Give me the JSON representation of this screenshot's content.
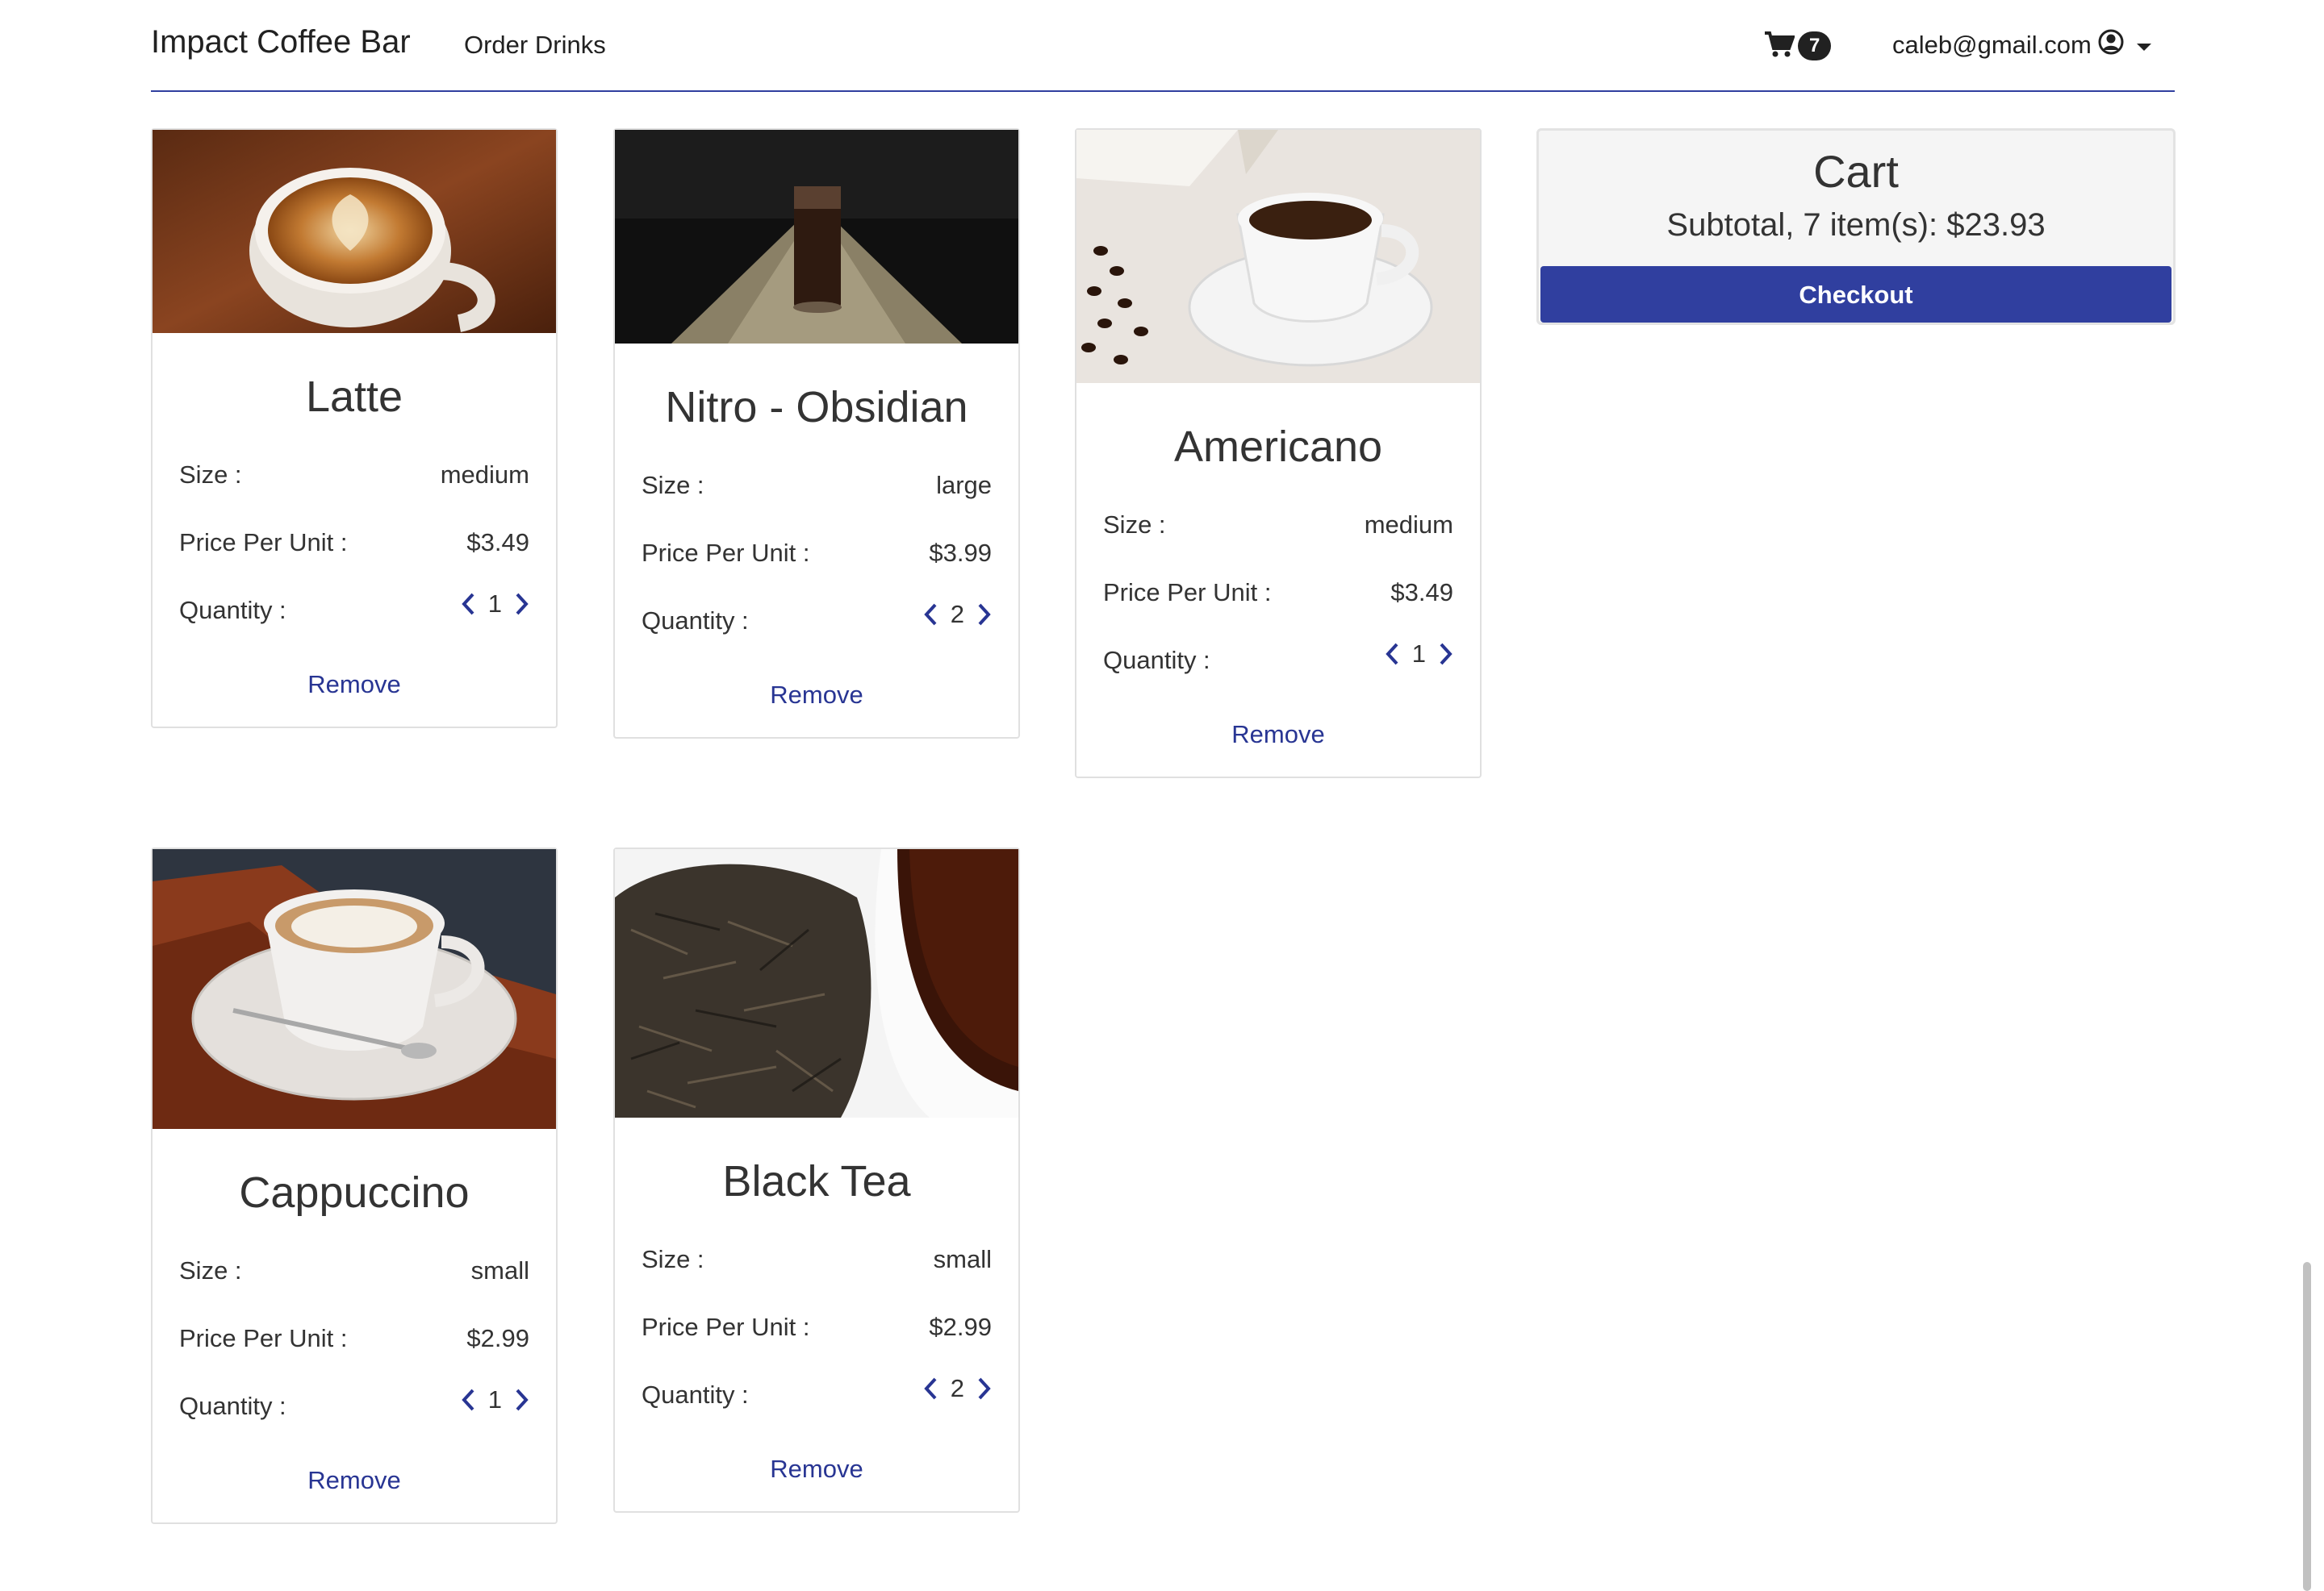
{
  "navbar": {
    "brand": "Impact Coffee Bar",
    "order_link": "Order Drinks",
    "cart_count": "7",
    "user_email": "caleb@gmail.com",
    "accent_color": "#303f9f"
  },
  "labels": {
    "size": "Size :",
    "price": "Price Per Unit :",
    "quantity": "Quantity :",
    "remove": "Remove"
  },
  "items": [
    {
      "name": "Latte",
      "size": "medium",
      "price": "$3.49",
      "quantity": "1"
    },
    {
      "name": "Nitro - Obsidian",
      "size": "large",
      "price": "$3.99",
      "quantity": "2"
    },
    {
      "name": "Americano",
      "size": "medium",
      "price": "$3.49",
      "quantity": "1"
    },
    {
      "name": "Cappuccino",
      "size": "small",
      "price": "$2.99",
      "quantity": "1"
    },
    {
      "name": "Black Tea",
      "size": "small",
      "price": "$2.99",
      "quantity": "2"
    }
  ],
  "cart": {
    "title": "Cart",
    "subtotal": "Subtotal, 7 item(s): $23.93",
    "checkout_label": "Checkout"
  },
  "icons": {
    "cart": "shopping-cart-icon",
    "user": "user-circle-icon",
    "caret": "caret-down-icon",
    "decrease": "chevron-left-icon",
    "increase": "chevron-right-icon"
  }
}
